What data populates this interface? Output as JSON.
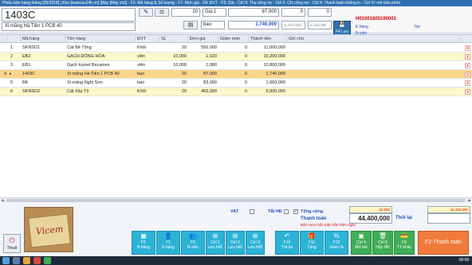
{
  "titlebar": "Phiếu bán hàng tháng [05/2018] | Kho [toancau24h.vn] |Máy [Máy chủ] - F5: Mã hàng & Số lượng - F7: Mức giá - F8: ĐVT - F9: Giá - Ctrl 9: Thu công nợ - Ctrl 0: Chi công nợ - Ctrl 4: Thanh toán không in - Ctrl O: mở bàn phím",
  "entry": {
    "code": "1403C",
    "name": "Xi măng Hà Tiên 1 PCB 40",
    "qty": "20",
    "price_level": "Giá 1",
    "price": "87,000",
    "disc1": "0",
    "disc2": "0",
    "unit": "bao",
    "amount": "1,740,000",
    "note1": "G.chú món",
    "note2": "G.chú HĐ",
    "f4_label": "F4 Lưu"
  },
  "invoice": {
    "number": "H01001805190001",
    "customer_label": "K.hàng",
    "staff_label": "N.viên",
    "debt_label": "Nợ"
  },
  "columns": [
    "Mã hàng",
    "Tên hàng",
    "ĐVT",
    "SL",
    "Đơn giá",
    "Giảm món",
    "Thành tiền",
    "Ghi chú"
  ],
  "rows": [
    {
      "no": "1",
      "code": "SKNSD1",
      "name": "Cát Bê Tông",
      "unit": "Khối",
      "qty": "20",
      "price": "550,000",
      "disc": "0",
      "total": "11,000,000",
      "note": ""
    },
    {
      "no": "2",
      "code": "EB2",
      "name": "GẠCH ĐỒNG HÒA",
      "unit": "viên",
      "qty": "10,000",
      "price": "1,020",
      "disc": "0",
      "total": "10,200,000",
      "note": ""
    },
    {
      "no": "3",
      "code": "EB1",
      "name": "Gạch tuynel Becamex",
      "unit": "viên",
      "qty": "10,000",
      "price": "1,080",
      "disc": "0",
      "total": "10,800,000",
      "note": ""
    },
    {
      "no": "4",
      "code": "1403C",
      "name": "Xi măng Hà Tiên 1 PCB 40",
      "unit": "bao",
      "qty": "20",
      "price": "87,000",
      "disc": "0",
      "total": "1,740,000",
      "note": ""
    },
    {
      "no": "5",
      "code": "BK",
      "name": "Xi măng Nghi Sơn",
      "unit": "bao",
      "qty": "20",
      "price": "83,000",
      "disc": "0",
      "total": "1,660,000",
      "note": ""
    },
    {
      "no": "6",
      "code": "SKNSD2",
      "name": "Cát Xây Tô",
      "unit": "Khối",
      "qty": "20",
      "price": "450,000",
      "disc": "0",
      "total": "9,000,000",
      "note": ""
    }
  ],
  "totals": {
    "vat_label": "VAT",
    "tat_hd_label": "Tắt HĐ",
    "tong_cong_label": "Tổng cộng",
    "subtotal_small": "20,000",
    "tong_cong_value": "44,400,000",
    "thanh_toan_label": "Thanh toán",
    "thanh_toan_value": "44,400,000",
    "thoi_lai_label": "Thối lại",
    "words": "Bốn mươi bốn triệu bốn trăm ngàn"
  },
  "exit_label": "Thoát",
  "photo_brand": "Vicem",
  "buttons": [
    {
      "key": "F5",
      "label": "B.hàng",
      "icon": "▦"
    },
    {
      "key": "F1",
      "label": "K.hàng",
      "icon": "👤"
    },
    {
      "key": "F6",
      "label": "N.viên",
      "icon": "👥"
    },
    {
      "key": "Ctrl 1",
      "label": "Lưu hđ1",
      "icon": "⊞"
    },
    {
      "key": "Ctrl 2",
      "label": "Lưu hđ2",
      "icon": "⊞"
    },
    {
      "key": "Ctrl 3",
      "label": "Lưu hđ3",
      "icon": "⊞"
    },
    {
      "key": "F10",
      "label": "Trả lại",
      "icon": "↶"
    },
    {
      "key": "F11",
      "label": "Tặng",
      "icon": "🎁"
    },
    {
      "key": "F12",
      "label": "Giảm %",
      "icon": "%"
    },
    {
      "key": "Ctrl 4",
      "label": "Mở két",
      "icon": "▣"
    },
    {
      "key": "Ctrl 8",
      "label": "Hủy HĐ",
      "icon": "🗑"
    },
    {
      "key": "F3",
      "label": "TT khác",
      "icon": "💳"
    },
    {
      "key": "F2",
      "label": "F2-Thanh toán",
      "icon": ""
    }
  ],
  "clock": "08:58",
  "colors": {
    "accent": "#2bb3d6",
    "primary": "#2f6fb0",
    "selected_row": "#fbd68a",
    "alt_row": "#fdf7c9",
    "danger": "#d20000"
  }
}
